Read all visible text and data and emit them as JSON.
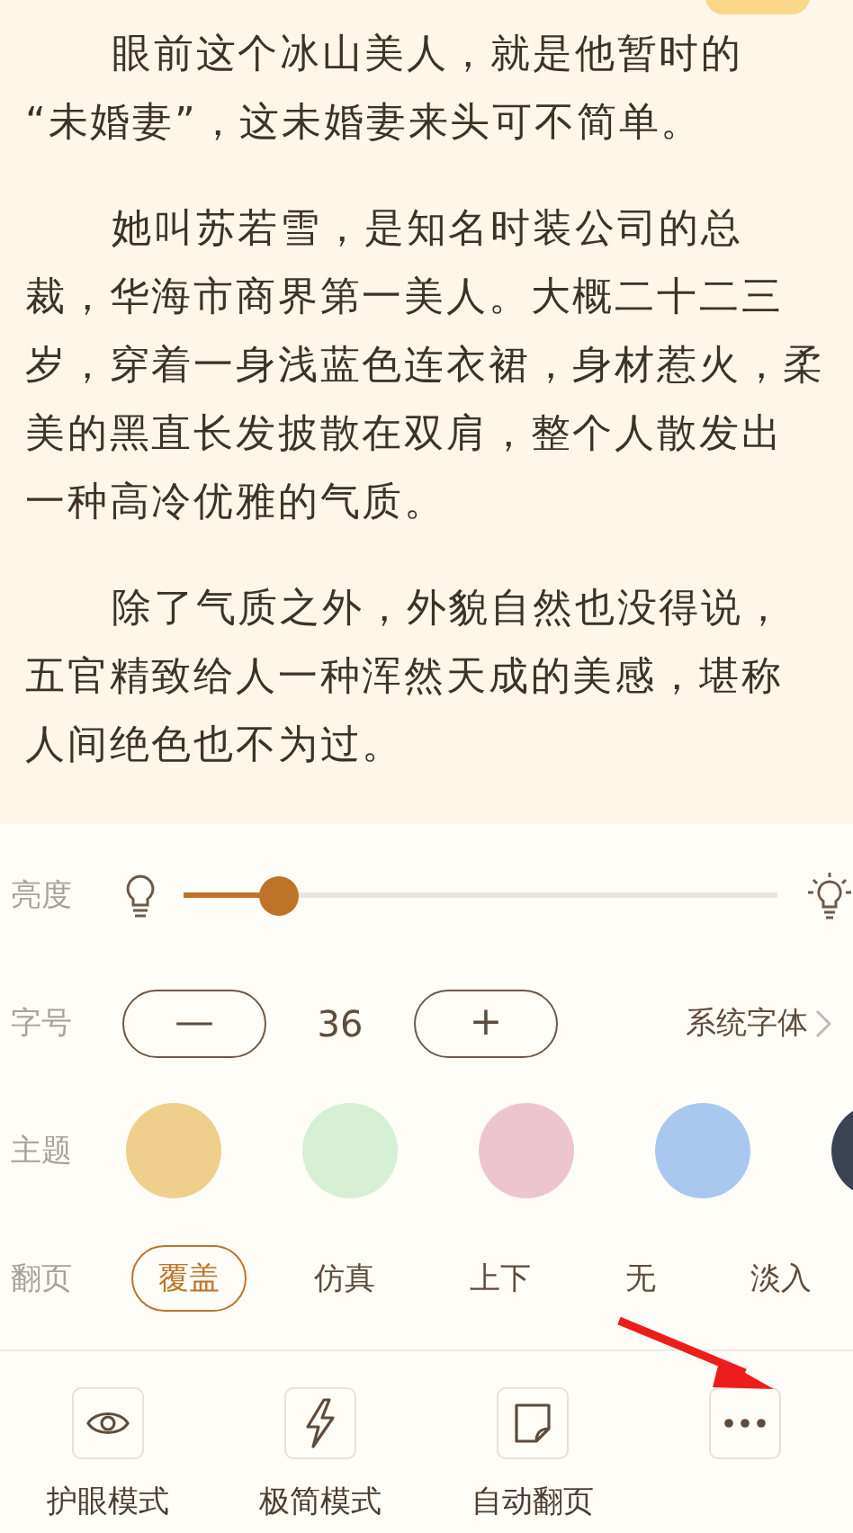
{
  "reading": {
    "paragraphs": [
      {
        "lines": [
          "眼前这个冰山美人，就是他暂时的",
          "“未婚妻”，这未婚妻来头可不简单。"
        ]
      },
      {
        "lines": [
          "她叫苏若雪，是知名时装公司的总",
          "裁，华海市商界第一美人。大概二十二三",
          "岁，穿着一身浅蓝色连衣裙，身材惹火，柔",
          "美的黑直长发披散在双肩，整个人散发出",
          "一种高冷优雅的气质。"
        ]
      },
      {
        "lines": [
          "除了气质之外，外貌自然也没得说，",
          "五官精致给人一种浑然天成的美感，堪称",
          "人间绝色也不为过。"
        ]
      }
    ]
  },
  "settings": {
    "brightness": {
      "label": "亮度",
      "level": 0.16
    },
    "font_size": {
      "label": "字号",
      "decrease": "—",
      "value": "36",
      "increase": "+",
      "font_link": "系统字体"
    },
    "theme": {
      "label": "主题",
      "options": [
        {
          "color": "#f0cf8c"
        },
        {
          "color": "#d5f0d4"
        },
        {
          "color": "#eec5cf"
        },
        {
          "color": "#a8c8ef"
        },
        {
          "color": "#3b4252"
        }
      ]
    },
    "page_turn": {
      "label": "翻页",
      "options": [
        {
          "label": "覆盖",
          "selected": true
        },
        {
          "label": "仿真",
          "selected": false
        },
        {
          "label": "上下",
          "selected": false
        },
        {
          "label": "无",
          "selected": false
        },
        {
          "label": "淡入",
          "selected": false
        }
      ]
    }
  },
  "toolbar": [
    {
      "kind": "eye",
      "label": "护眼模式"
    },
    {
      "kind": "bolt",
      "label": "极简模式"
    },
    {
      "kind": "note",
      "label": "自动翻页"
    },
    {
      "kind": "more"
    }
  ]
}
